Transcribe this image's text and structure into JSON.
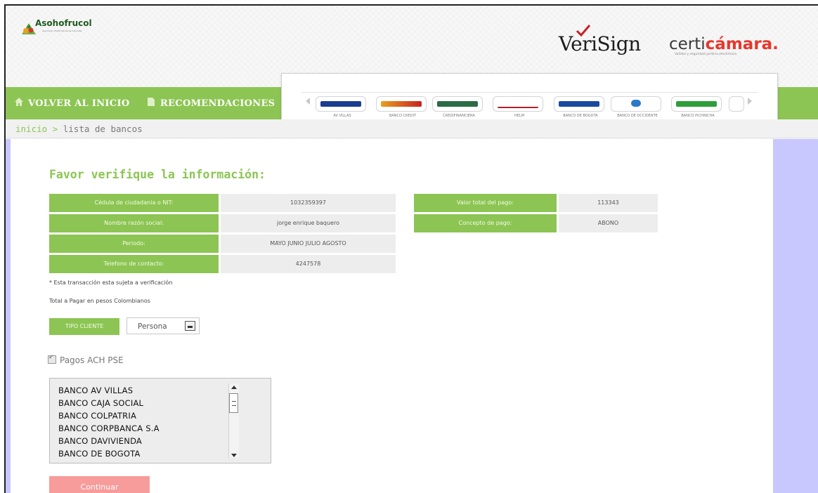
{
  "header": {
    "brand": "Asohofrucol",
    "brand_sub": "Asociación Hortifrutícola de Colombia",
    "verisign": "VeriSign",
    "certi_a": "certi",
    "certi_b": "cámara.",
    "certi_tag": "Validez y seguridad jurídica electrónica"
  },
  "nav": {
    "home": "VOLVER AL INICIO",
    "recommendations": "RECOMENDACIONES"
  },
  "carousel": {
    "banks": [
      {
        "caption": "AV VILLAS",
        "color": "#1b3d8f"
      },
      {
        "caption": "BANCO CREDIT",
        "color": "#e8a020"
      },
      {
        "caption": "CREDIFINANCIERA",
        "color": "#2b6b45"
      },
      {
        "caption": "HELM",
        "color": "#b0202a"
      },
      {
        "caption": "BANCO DE BOGOTA",
        "color": "#1a4aa0"
      },
      {
        "caption": "BANCO DE OCCIDENTE",
        "color": "#2a7ac8"
      },
      {
        "caption": "BANCO PICHINCHA",
        "color": "#2e9d3a"
      }
    ]
  },
  "breadcrumb": {
    "home": "inicio >",
    "current": "lista de bancos"
  },
  "main": {
    "heading": "Favor verifique la información:",
    "left_rows": [
      {
        "label": "Cédula de ciudadania o NIT:",
        "value": "1032359397"
      },
      {
        "label": "Nombre razón social:",
        "value": "jorge enrique baquero"
      },
      {
        "label": "Periodo:",
        "value": "MAYO JUNIO JULIO AGOSTO"
      },
      {
        "label": "Telefono de contacto:",
        "value": "4247578"
      }
    ],
    "right_rows": [
      {
        "label": "Valor total del pago:",
        "value": "113343"
      },
      {
        "label": "Concepto de pago:",
        "value": "ABONO"
      }
    ],
    "note1": "* Esta transacción esta sujeta a verificación",
    "note2": "Total a Pagar en pesos Colombianos",
    "tipo_label": "TIPO CLIENTE",
    "tipo_value": "Persona",
    "ach_label": "Pagos ACH PSE",
    "banks_list": [
      "BANCO AV VILLAS",
      "BANCO CAJA SOCIAL",
      "BANCO COLPATRIA",
      "BANCO CORPBANCA S.A",
      "BANCO DAVIVIENDA",
      "BANCO DE BOGOTA"
    ],
    "continue": "Continuar"
  },
  "colors": {
    "accent": "#8cc553",
    "button_disabled": "#f79b9b",
    "gutter": "#c8c8ff"
  }
}
